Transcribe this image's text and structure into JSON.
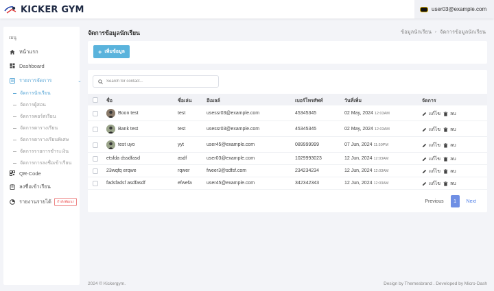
{
  "brand": {
    "name": "KICKER GYM"
  },
  "user": {
    "email": "user03@example.com"
  },
  "sidebar": {
    "heading": "เมนู",
    "items": [
      {
        "label": "หน้าแรก",
        "icon": "home-icon"
      },
      {
        "label": "Dashboard",
        "icon": "dashboard-icon"
      },
      {
        "label": "รายการจัดการ",
        "icon": "list-icon"
      },
      {
        "label": "QR-Code",
        "icon": "qrcode-icon"
      },
      {
        "label": "ลงชื่อเข้าเรียน",
        "icon": "clipboard-icon"
      },
      {
        "label": "รายงานรายได้",
        "icon": "report-icon",
        "badge": "กำลังพัฒนา"
      }
    ],
    "sub_items": [
      "จัดการนักเรียน",
      "จัดการผู้สอน",
      "จัดการคอร์สเรียน",
      "จัดการตารางเรียน",
      "จัดการตารางเรียนพิเศษ",
      "จัดการรายการชำระเงิน",
      "จัดการการลงชื่อเข้าเรียน"
    ]
  },
  "page": {
    "title": "จัดการข้อมูลนักเรียน",
    "breadcrumb": [
      "ข้อมูลนักเรียน",
      "จัดการข้อมูลนักเรียน"
    ],
    "add_button": "เพิ่มข้อมูล",
    "search_placeholder": "Search for contact..."
  },
  "table": {
    "headers": [
      "ชื่อ",
      "ชื่อเล่น",
      "อีเมลล์",
      "เบอร์โทรศัพท์",
      "วันที่เพิ่ม",
      "จัดการ"
    ],
    "rows": [
      {
        "name": "Boon test",
        "nick": "test",
        "email": "usessr03@example.com",
        "phone": "45345345",
        "date": "02 May, 2024",
        "time": "12:03AM",
        "avatar": true
      },
      {
        "name": "Bank test",
        "nick": "test",
        "email": "usessr03@example.com",
        "phone": "45345345",
        "date": "02 May, 2024",
        "time": "12:03AM",
        "avatar": true
      },
      {
        "name": "test uyo",
        "nick": "yyt",
        "email": "user45@example.com",
        "phone": "089999999",
        "date": "07 Jun, 2024",
        "time": "11:50PM",
        "avatar": true
      },
      {
        "name": "etsfda dssdfasd",
        "nick": "asdf",
        "email": "user03@example.com",
        "phone": "1029993023",
        "date": "12 Jun, 2024",
        "time": "12:03AM",
        "avatar": false
      },
      {
        "name": "23wqfq erqwe",
        "nick": "rqwer",
        "email": "fweer3@sdfsf.com",
        "phone": "234234234",
        "date": "12 Jun, 2024",
        "time": "12:03AM",
        "avatar": false
      },
      {
        "name": "fadsfadsf asdfasdf",
        "nick": "efwefa",
        "email": "user45@example.com",
        "phone": "342342343",
        "date": "12 Jun, 2024",
        "time": "12:03AM",
        "avatar": false
      }
    ],
    "edit_label": "แก้ไข",
    "delete_label": "ลบ"
  },
  "pagination": {
    "prev": "Previous",
    "current": "1",
    "next": "Next"
  },
  "footer": {
    "left": "2024 © Kickergym.",
    "right": "Design by Themesbrand . Developed by Micro-Dash"
  },
  "colors": {
    "accent": "#5ab3dc",
    "page_bg": "#f3f4f8",
    "pager_active": "#6f8fe4"
  }
}
